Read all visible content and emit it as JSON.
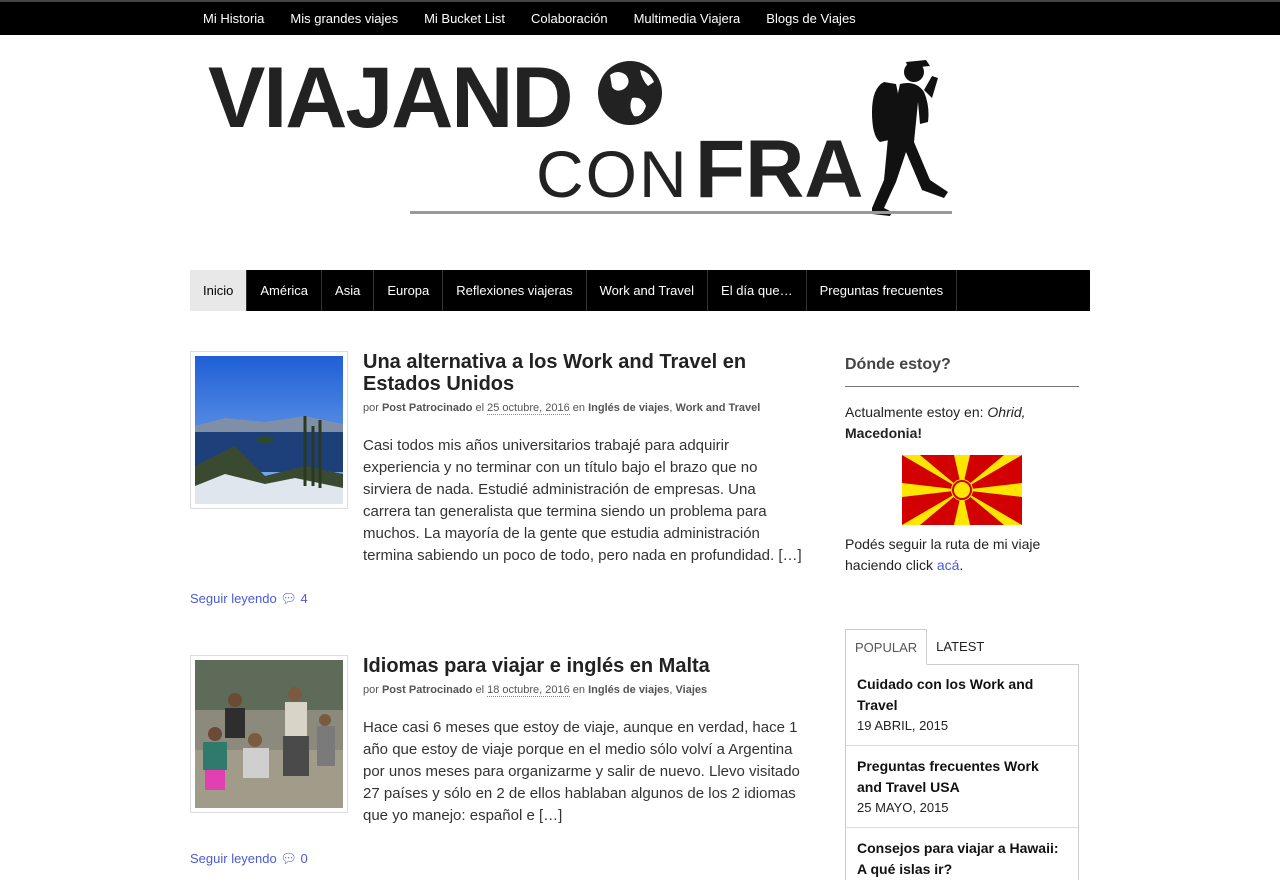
{
  "top_nav": [
    "Mi Historia",
    "Mis grandes viajes",
    "Mi Bucket List",
    "Colaboración",
    "Multimedia Viajera",
    "Blogs de Viajes"
  ],
  "logo": {
    "line1": "VIAJAND",
    "line2a": "CON",
    "line2b": "FRA"
  },
  "main_nav": [
    "Inicio",
    "América",
    "Asia",
    "Europa",
    "Reflexiones viajeras",
    "Work and Travel",
    "El día que…",
    "Preguntas frecuentes"
  ],
  "posts": [
    {
      "title": "Una alternativa a los Work and Travel en Estados Unidos",
      "by": "por",
      "author": "Post Patrocinado",
      "el": "el",
      "date": "25 octubre, 2016",
      "en": "en",
      "cat1": "Inglés de viajes",
      "cat2": "Work and Travel",
      "excerpt": "Casi todos mis años universitarios trabajé para adquirir experiencia y no terminar con un título bajo el brazo que no sirviera de nada. Estudié administración de empresas. Una carrera tan generalista que termina siendo un problema para muchos. La mayoría de la gente que estudia administración termina sabiendo un poco de todo, pero nada en profundidad. […]",
      "readmore": "Seguir leyendo",
      "comments": "4"
    },
    {
      "title": "Idiomas para viajar e inglés en Malta",
      "by": "por",
      "author": "Post Patrocinado",
      "el": "el",
      "date": "18 octubre, 2016",
      "en": "en",
      "cat1": "Inglés de viajes",
      "cat2": "Viajes",
      "excerpt": "Hace casi 6 meses que estoy de viaje, aunque en verdad, hace 1 año que estoy de viaje porque en el medio sólo volví a Argentina por unos meses para organizarme y salir de nuevo. Llevo visitado 27 países y sólo en 2 de ellos hablaban algunos de los 2 idiomas que yo manejo: español e […]",
      "readmore": "Seguir leyendo",
      "comments": "0"
    }
  ],
  "sidebar": {
    "title": "Dónde estoy?",
    "location_prefix": "Actualmente estoy en: ",
    "location_city": "Ohrid,",
    "location_country": "Macedonia!",
    "route_text": "Podés seguir la ruta de mi viaje haciendo click ",
    "route_link": "acá",
    "route_end": ".",
    "tabs": [
      "POPULAR",
      "LATEST"
    ],
    "popular": [
      {
        "title": "Cuidado con los Work and Travel",
        "date": "19 ABRIL, 2015"
      },
      {
        "title": "Preguntas frecuentes Work and Travel USA",
        "date": "25 MAYO, 2015"
      },
      {
        "title": "Consejos para viajar a Hawaii: A qué islas ir?",
        "date": ""
      }
    ]
  },
  "colors": {
    "nav_bg": "#000000",
    "link": "#4a5bd4",
    "flag_red": "#d20000",
    "flag_yellow": "#ffe600"
  }
}
